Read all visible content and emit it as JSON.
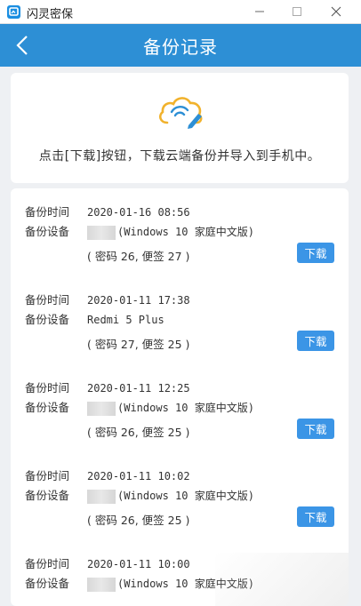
{
  "window": {
    "title": "闪灵密保",
    "controls": [
      "minimize",
      "maximize",
      "close"
    ]
  },
  "header": {
    "title": "备份记录",
    "back_icon": "chevron-left-icon"
  },
  "info": {
    "icon": "cloud-edit-icon",
    "text": "点击[下载]按钮，下载云端备份并导入到手机中。",
    "accent_color": "#f1b22c",
    "icon_line_color": "#2d8fd5"
  },
  "records": {
    "time_label": "备份时间",
    "device_label": "备份设备",
    "download_label": "下载",
    "items": [
      {
        "time": "2020-01-16 08:56",
        "device": "(Windows 10 家庭中文版)",
        "device_redacted": true,
        "detail": "( 密码 26, 便签 27 )"
      },
      {
        "time": "2020-01-11 17:38",
        "device": "Redmi 5 Plus",
        "device_redacted": false,
        "detail": "( 密码 27, 便签 25 )"
      },
      {
        "time": "2020-01-11 12:25",
        "device": "(Windows 10 家庭中文版)",
        "device_redacted": true,
        "detail": "( 密码 26, 便签 25 )"
      },
      {
        "time": "2020-01-11 10:02",
        "device": "(Windows 10 家庭中文版)",
        "device_redacted": true,
        "detail": "( 密码 26, 便签 25 )"
      },
      {
        "time": "2020-01-11 10:00",
        "device": "(Windows 10 家庭中文版)",
        "device_redacted": true,
        "detail": ""
      }
    ]
  },
  "colors": {
    "header_bg": "#2d8fd5",
    "button_bg": "#3b95e6",
    "page_bg": "#eef0f3"
  }
}
